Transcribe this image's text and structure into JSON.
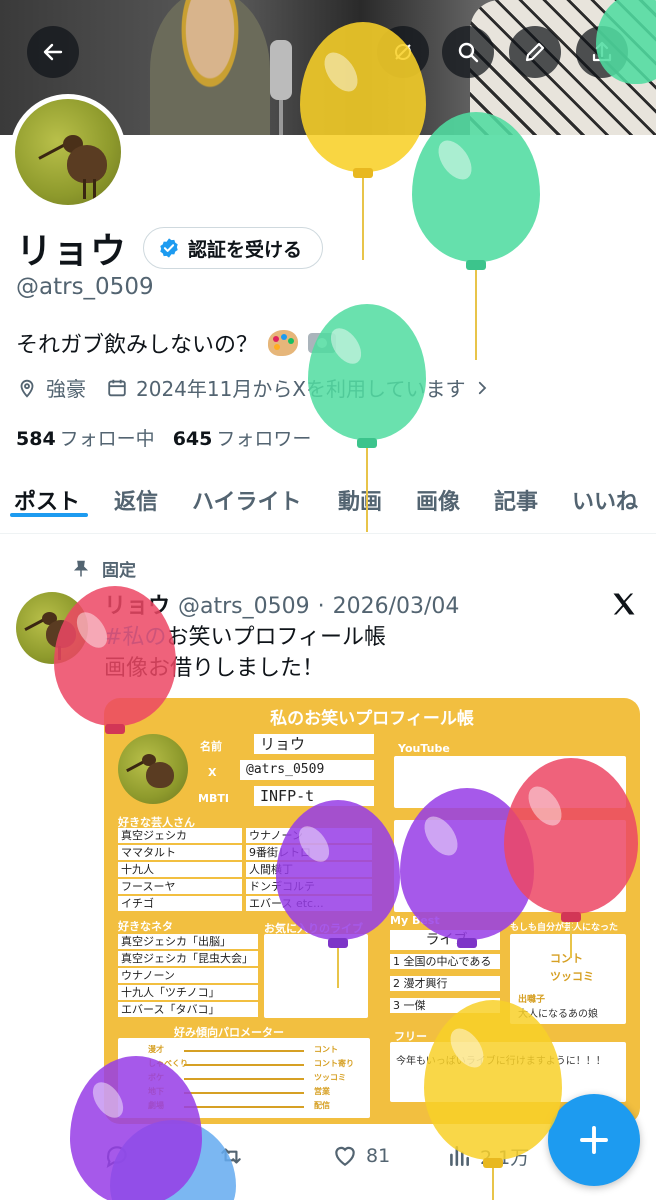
{
  "profile": {
    "name": "リョウ",
    "verify_button": "認証を受ける",
    "handle": "@atrs_0509",
    "bio": "それガブ飲みしないの？",
    "bio_emoji": [
      "palette-icon",
      "camera-icon"
    ],
    "location": "強豪",
    "joined": "2024年11月からXを利用しています",
    "following_count": "584",
    "following_label": "フォロー中",
    "followers_count": "645",
    "followers_label": "フォロワー"
  },
  "tabs": [
    {
      "label": "ポスト",
      "active": true
    },
    {
      "label": "返信"
    },
    {
      "label": "ハイライト"
    },
    {
      "label": "動画"
    },
    {
      "label": "画像"
    },
    {
      "label": "記事"
    },
    {
      "label": "いいね"
    }
  ],
  "post": {
    "pinned_label": "固定",
    "author_name": "リョウ",
    "author_handle": "@atrs_0509",
    "date": "2026/03/04",
    "hashtag": "#私の",
    "text_line1_rest": "お笑いプロフィール帳",
    "text_line2": "画像お借りしました！",
    "likes": "81",
    "views": "2.1万"
  },
  "card": {
    "title": "私のお笑いプロフィール帳",
    "labels": {
      "name": "名前",
      "x": "X",
      "mbti": "MBTI",
      "youtube": "YouTube",
      "fav_comedians": "好きな芸人さん",
      "fav_neta": "好きなネタ",
      "fav_places": "お気に入りのライブ",
      "my_best": "My Best",
      "if_comedian": "もしも自分が芸人になったら…？",
      "meter": "好み傾向パロメーター",
      "free": "フリー"
    },
    "values": {
      "name": "リョウ",
      "x": "@atrs_0509",
      "mbti": "INFP-t"
    },
    "comedians": [
      "真空ジェシカ",
      "ママタルト",
      "十九人",
      "フースーヤ",
      "イチゴ"
    ],
    "comedians2": [
      "ウナノーン",
      "9番街レトロ",
      "人間横丁",
      "ドンデコルテ",
      "エバース etc..."
    ],
    "neta": [
      "真空ジェシカ「出脳」",
      "真空ジェシカ「昆虫大会」",
      "ウナノーン",
      "十九人「ツチノコ」",
      "エバース「タバコ」"
    ],
    "best": [
      "ライブ",
      "1 全国の中心である",
      "2 漫才興行",
      "3 一傑"
    ],
    "role_conte": "コント",
    "role_tsukkomi": "ツッコミ",
    "debayashi": "出囃子",
    "debayashi_value": "大人になるあの娘",
    "free_text": "今年もいっぱいライブに行けますように！！！",
    "meter_left": [
      "漫才",
      "しゃべくり",
      "ボケ",
      "地下",
      "劇場"
    ],
    "meter_right": [
      "コント",
      "コント寄り",
      "ツッコミ",
      "営業",
      "配信"
    ]
  },
  "colors": {
    "accent": "#1d9bf0",
    "text": "#0f1419",
    "muted": "#536471",
    "card_bg": "#f2bf40"
  }
}
